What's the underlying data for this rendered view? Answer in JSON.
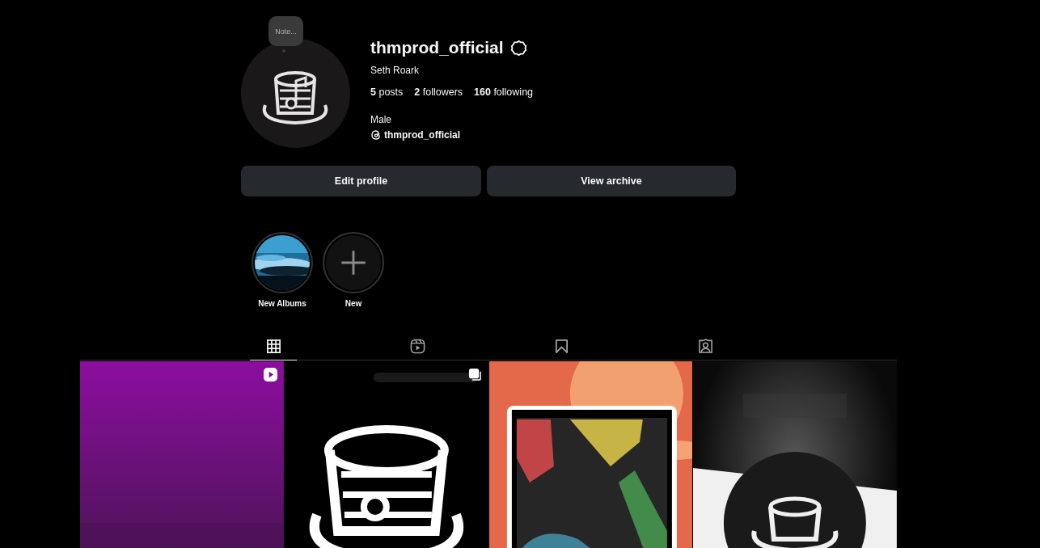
{
  "profile": {
    "note": "Note...",
    "username": "thmprod_official",
    "verified": true,
    "name": "Seth Roark",
    "stats": [
      "**5** posts",
      "**2** followers",
      "**160** following"
    ],
    "bio": "Male",
    "threads_handle": "thmprod_official"
  },
  "buttons": [
    "Edit profile",
    "View archive"
  ],
  "highlights": [
    {
      "label": "New Albums",
      "kind": "picture"
    },
    {
      "label": "New",
      "kind": "add"
    }
  ],
  "tabs": [
    {
      "kind": "grid",
      "selected": true
    },
    {
      "kind": "reels",
      "selected": false
    },
    {
      "kind": "saved",
      "selected": false
    },
    {
      "kind": "tagged",
      "selected": false
    }
  ],
  "posts": [
    {
      "kind": "picture",
      "reel": true,
      "carousel": false
    },
    {
      "kind": "picture",
      "reel": false,
      "carousel": true
    },
    {
      "kind": "picture",
      "reel": false,
      "carousel": false
    },
    {
      "kind": "picture",
      "reel": false,
      "carousel": false
    }
  ]
}
